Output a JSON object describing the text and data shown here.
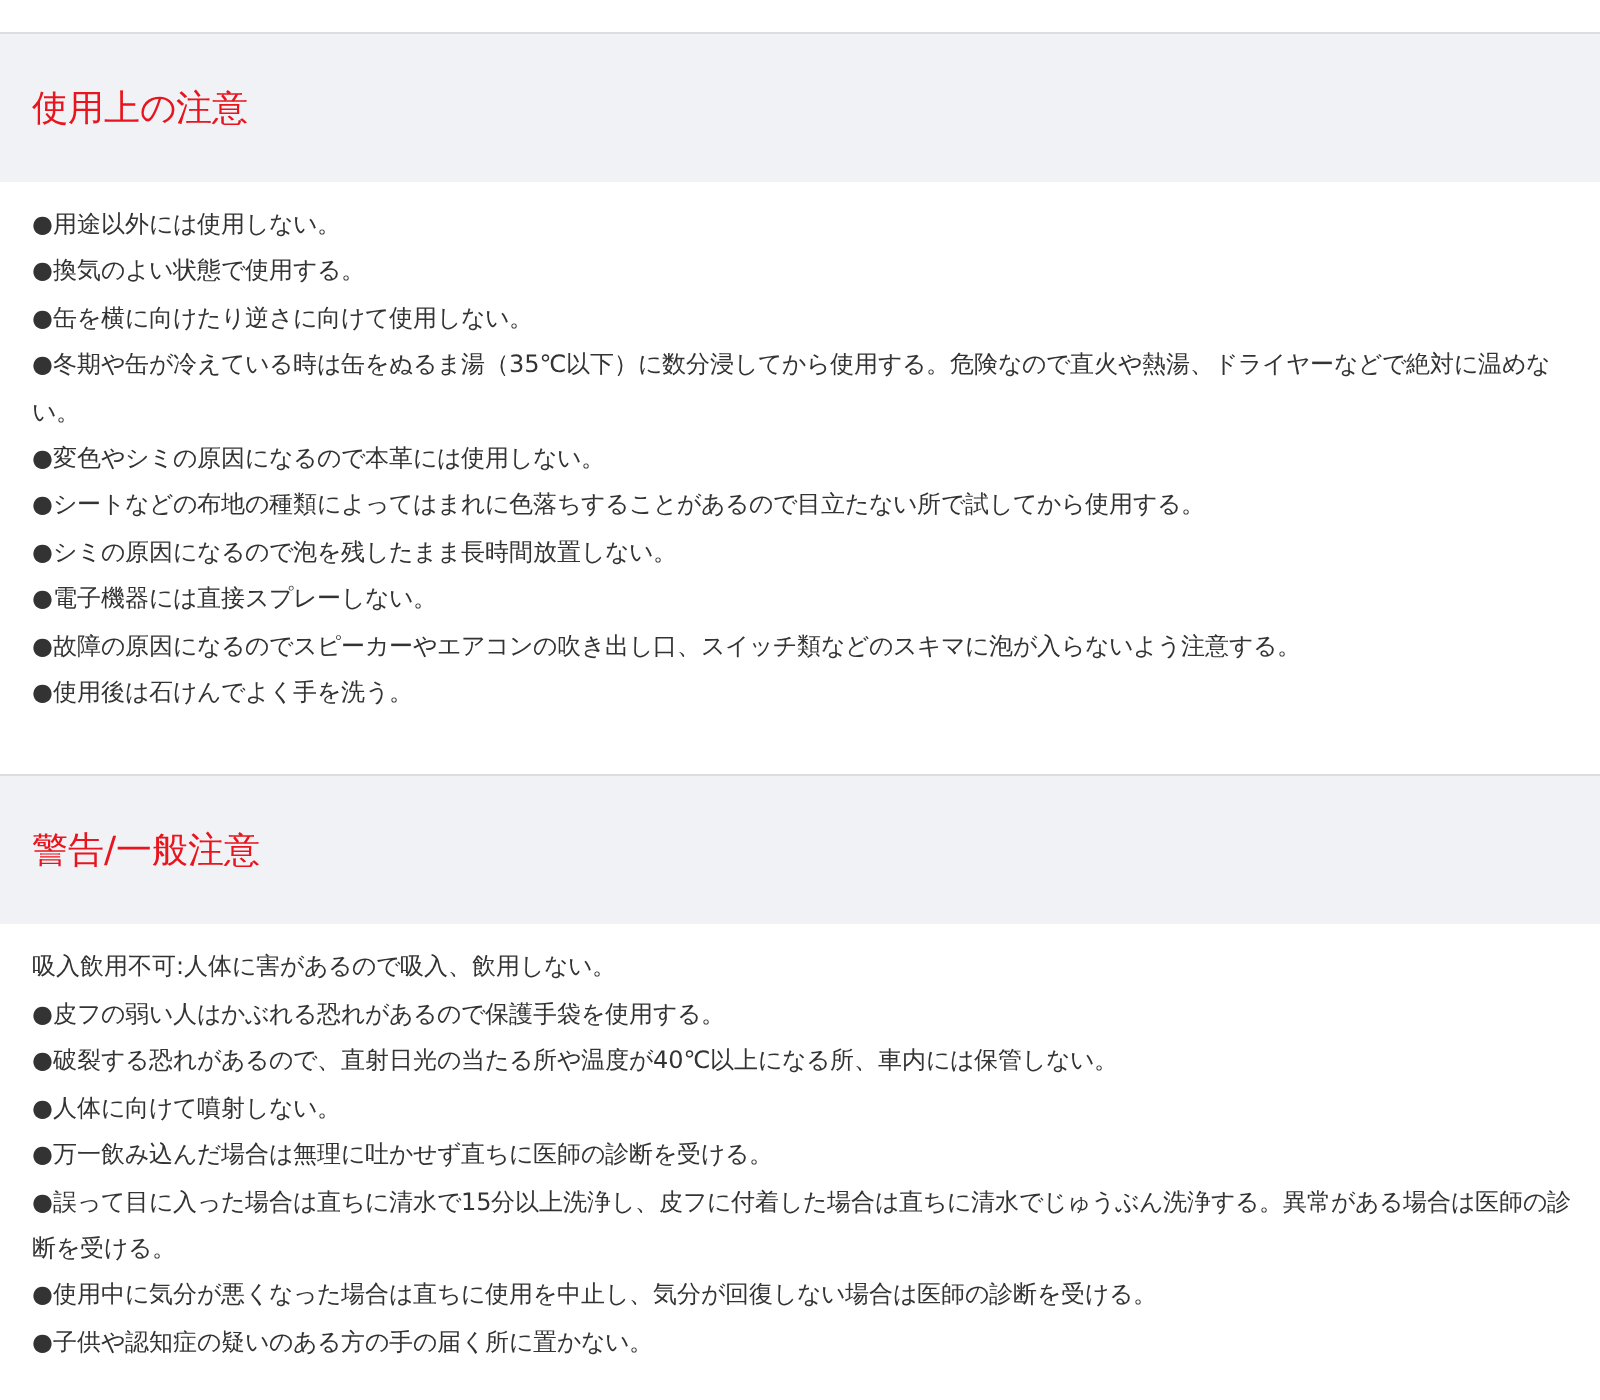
{
  "sections": [
    {
      "title": "使用上の注意",
      "items": [
        "●用途以外には使用しない。",
        "●換気のよい状態で使用する。",
        "●缶を横に向けたり逆さに向けて使用しない。",
        "●冬期や缶が冷えている時は缶をぬるま湯（35℃以下）に数分浸してから使用する。危険なので直火や熱湯、ドライヤーなどで絶対に温めない。",
        "●変色やシミの原因になるので本革には使用しない。",
        "●シートなどの布地の種類によってはまれに色落ちすることがあるので目立たない所で試してから使用する。",
        "●シミの原因になるので泡を残したまま長時間放置しない。",
        "●電子機器には直接スプレーしない。",
        "●故障の原因になるのでスピーカーやエアコンの吹き出し口、スイッチ類などのスキマに泡が入らないよう注意する。",
        "●使用後は石けんでよく手を洗う。"
      ]
    },
    {
      "title": "警告/一般注意",
      "items": [
        "吸入飲用不可:人体に害があるので吸入、飲用しない。",
        "●皮フの弱い人はかぶれる恐れがあるので保護手袋を使用する。",
        "●破裂する恐れがあるので、直射日光の当たる所や温度が40℃以上になる所、車内には保管しない。",
        "●人体に向けて噴射しない。",
        "●万一飲み込んだ場合は無理に吐かせず直ちに医師の診断を受ける。",
        "●誤って目に入った場合は直ちに清水で15分以上洗浄し、皮フに付着した場合は直ちに清水でじゅうぶん洗浄する。異常がある場合は医師の診断を受ける。",
        "●使用中に気分が悪くなった場合は直ちに使用を中止し、気分が回復しない場合は医師の診断を受ける。",
        "●子供や認知症の疑いのある方の手の届く所に置かない。"
      ]
    }
  ]
}
